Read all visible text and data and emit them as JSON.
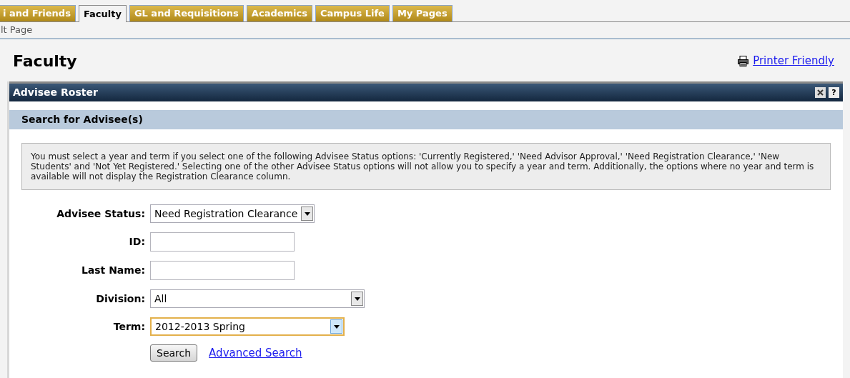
{
  "tabs": [
    {
      "label": "i and Friends",
      "selected": false
    },
    {
      "label": "Faculty",
      "selected": true
    },
    {
      "label": "GL and Requisitions",
      "selected": false
    },
    {
      "label": "Academics",
      "selected": false
    },
    {
      "label": "Campus Life",
      "selected": false
    },
    {
      "label": "My Pages",
      "selected": false
    }
  ],
  "breadcrumb": "lt Page",
  "page_title": "Faculty",
  "printer_link": "Printer Friendly",
  "portlet": {
    "title": "Advisee Roster",
    "help_label": "?",
    "section_title": "Search for Advisee(s)",
    "note": "You must select a year and term if you select one of the following Advisee Status options: 'Currently Registered,' 'Need Advisor Approval,' 'Need Registration Clearance,' 'New Students' and 'Not Yet Registered.' Selecting one of the other Advisee Status options will not allow you to specify a year and term. Additionally, the options where no year and term is available will not display the Registration Clearance column.",
    "fields": [
      {
        "kind": "select",
        "label": "Advisee Status:",
        "value": "Need Registration Clearance",
        "focused": false
      },
      {
        "kind": "text",
        "label": "ID:",
        "focused": false
      },
      {
        "kind": "text",
        "label": "Last Name:",
        "focused": false
      },
      {
        "kind": "select",
        "label": "Division:",
        "value": "All",
        "focused": false
      },
      {
        "kind": "select",
        "label": "Term:",
        "value": "2012-2013 Spring",
        "focused": true
      }
    ],
    "search_button": "Search",
    "advanced_link": "Advanced Search"
  }
}
